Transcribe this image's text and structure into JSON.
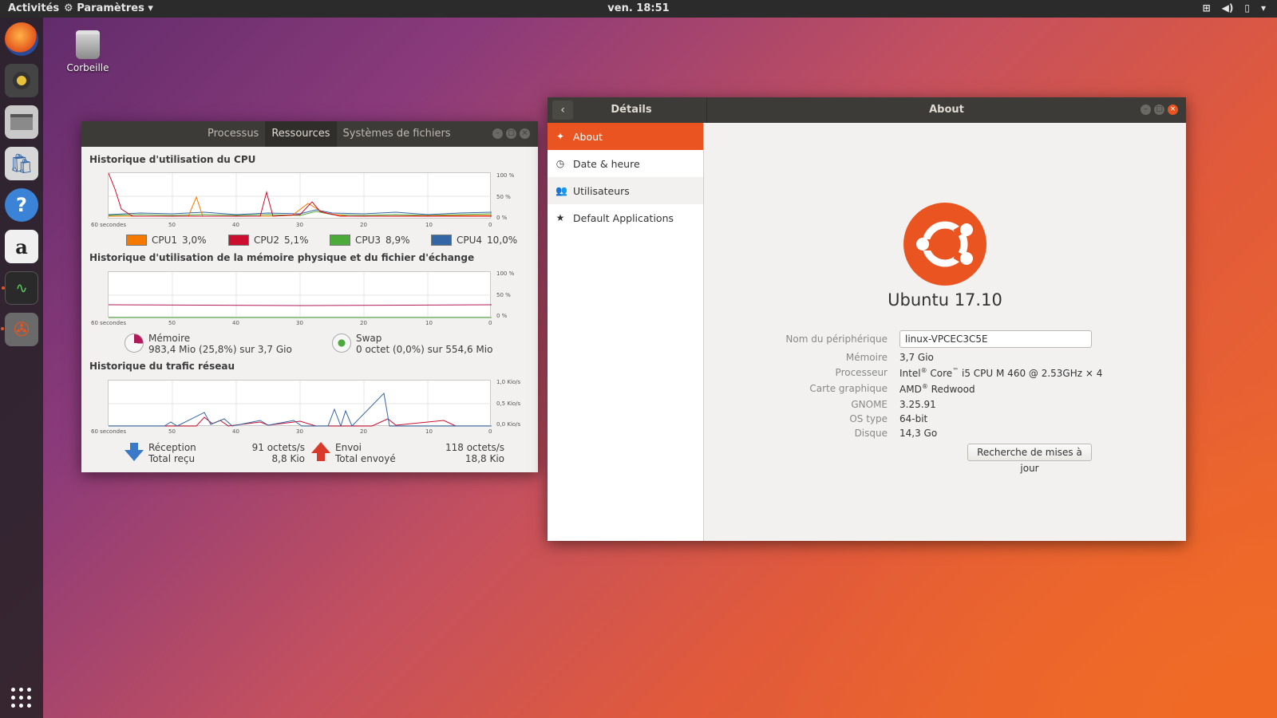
{
  "topbar": {
    "activities": "Activités",
    "app_menu": "Paramètres ▾",
    "clock": "ven. 18:51"
  },
  "desktop": {
    "trash_label": "Corbeille"
  },
  "sysmon": {
    "tabs": [
      "Processus",
      "Ressources",
      "Systèmes de fichiers"
    ],
    "cpu_title": "Historique d'utilisation du CPU",
    "mem_title": "Historique d'utilisation de la mémoire physique et du fichier d'échange",
    "net_title": "Historique du trafic réseau",
    "y_labels_pct": [
      "100 %",
      "50 %",
      "0 %"
    ],
    "y_labels_net": [
      "1,0 Kio/s",
      "0,5 Kio/s",
      "0,0 Kio/s"
    ],
    "x_labels": [
      "60 secondes",
      "50",
      "40",
      "30",
      "20",
      "10",
      "0"
    ],
    "cpus": [
      {
        "name": "CPU1",
        "value": "3,0%",
        "color": "#f57900"
      },
      {
        "name": "CPU2",
        "value": "5,1%",
        "color": "#cc0e2e"
      },
      {
        "name": "CPU3",
        "value": "8,9%",
        "color": "#4caa3a"
      },
      {
        "name": "CPU4",
        "value": "10,0%",
        "color": "#3465a4"
      }
    ],
    "memory": {
      "label": "Mémoire",
      "detail": "983,4 Mio (25,8%) sur 3,7 Gio"
    },
    "swap": {
      "label": "Swap",
      "detail": "0 octet (0,0%) sur 554,6 Mio"
    },
    "net": {
      "recv_label": "Réception",
      "recv_total_label": "Total reçu",
      "recv_rate": "91 octets/s",
      "recv_total": "8,8 Kio",
      "send_label": "Envoi",
      "send_total_label": "Total envoyé",
      "send_rate": "118 octets/s",
      "send_total": "18,8 Kio"
    }
  },
  "settings": {
    "left_title": "Détails",
    "right_title": "About",
    "sidebar": [
      {
        "label": "About",
        "icon": "✦"
      },
      {
        "label": "Date & heure",
        "icon": "◷"
      },
      {
        "label": "Utilisateurs",
        "icon": "👥"
      },
      {
        "label": "Default Applications",
        "icon": "★"
      }
    ],
    "os_name": "Ubuntu 17.10",
    "device_name_label": "Nom du périphérique",
    "device_name": "linux-VPCEC3C5E",
    "memory_label": "Mémoire",
    "memory": "3,7 Gio",
    "cpu_label": "Processeur",
    "cpu_a": "Intel",
    "cpu_b": "Core",
    "cpu_c": "i5 CPU M 460 @ 2.53GHz × 4",
    "gpu_label": "Carte graphique",
    "gpu_a": "AMD",
    "gpu_b": "Redwood",
    "gnome_label": "GNOME",
    "gnome": "3.25.91",
    "ostype_label": "OS type",
    "ostype": "64-bit",
    "disk_label": "Disque",
    "disk": "14,3 Go",
    "update_button": "Recherche de mises à jour"
  }
}
